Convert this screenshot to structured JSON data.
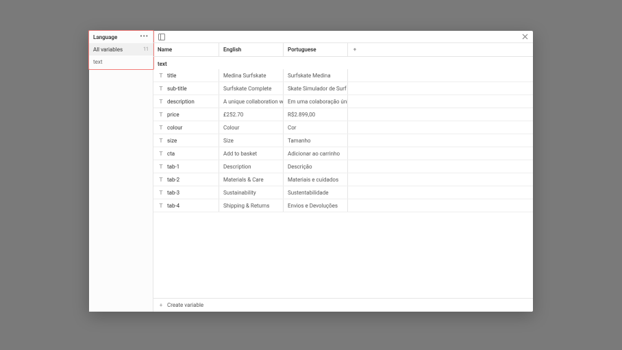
{
  "sidebar": {
    "collection_label": "Language",
    "items": [
      {
        "label": "All variables",
        "count": "11"
      },
      {
        "label": "text"
      }
    ]
  },
  "columns": {
    "name": "Name",
    "mode1": "English",
    "mode2": "Portuguese"
  },
  "section_title": "text",
  "rows": [
    {
      "name": "title",
      "english": "Medina Surfskate",
      "portuguese": "Surfskate Medina"
    },
    {
      "name": "sub-title",
      "english": "Surfskate Complete",
      "portuguese": "Skate Simulador de Surf Completo"
    },
    {
      "name": "description",
      "english": "A unique collaboration with three",
      "portuguese": "Em uma colaboração única com o"
    },
    {
      "name": "price",
      "english": "£252.70",
      "portuguese": "R$2.899,00"
    },
    {
      "name": "colour",
      "english": "Colour",
      "portuguese": "Cor"
    },
    {
      "name": "size",
      "english": "Size",
      "portuguese": "Tamanho"
    },
    {
      "name": "cta",
      "english": "Add to basket",
      "portuguese": "Adicionar ao carrinho"
    },
    {
      "name": "tab-1",
      "english": "Description",
      "portuguese": "Descrição"
    },
    {
      "name": "tab-2",
      "english": "Materials & Care",
      "portuguese": "Materiais e cuidados"
    },
    {
      "name": "tab-3",
      "english": "Sustainability",
      "portuguese": "Sustentabilidade"
    },
    {
      "name": "tab-4",
      "english": "Shipping & Returns",
      "portuguese": "Envios e Devoluções"
    }
  ],
  "footer": {
    "create": "Create variable"
  }
}
